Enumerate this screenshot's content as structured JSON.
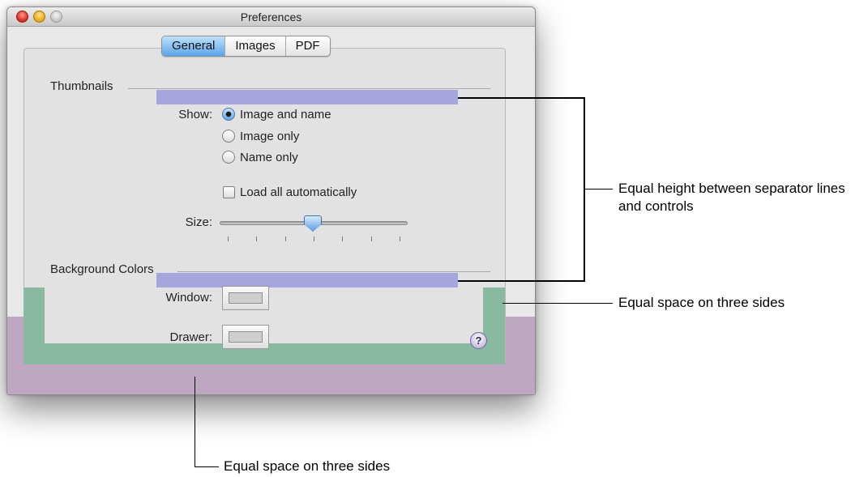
{
  "window": {
    "title": "Preferences",
    "tabs": [
      {
        "label": "General",
        "active": true
      },
      {
        "label": "Images",
        "active": false
      },
      {
        "label": "PDF",
        "active": false
      }
    ]
  },
  "thumbnails": {
    "heading": "Thumbnails",
    "show_label": "Show:",
    "options": [
      {
        "label": "Image and name",
        "selected": true
      },
      {
        "label": "Image only",
        "selected": false
      },
      {
        "label": "Name only",
        "selected": false
      }
    ],
    "load_all_label": "Load all automatically",
    "load_all_checked": false,
    "size_label": "Size:",
    "size_level": 0.5,
    "size_ticks": 7
  },
  "background_colors": {
    "heading": "Background Colors",
    "window_label": "Window:",
    "drawer_label": "Drawer:"
  },
  "help": {
    "glyph": "?"
  },
  "annotations": {
    "separators": "Equal height between separator lines and controls",
    "sides_right": "Equal space on three sides",
    "sides_bottom": "Equal space on three sides"
  },
  "colors": {
    "overlay_purple": "#bfa6c3",
    "overlay_green": "#8ab9a2",
    "overlay_blue_bar": "#a7a5dd",
    "tab_active": "#5aa5ea"
  }
}
